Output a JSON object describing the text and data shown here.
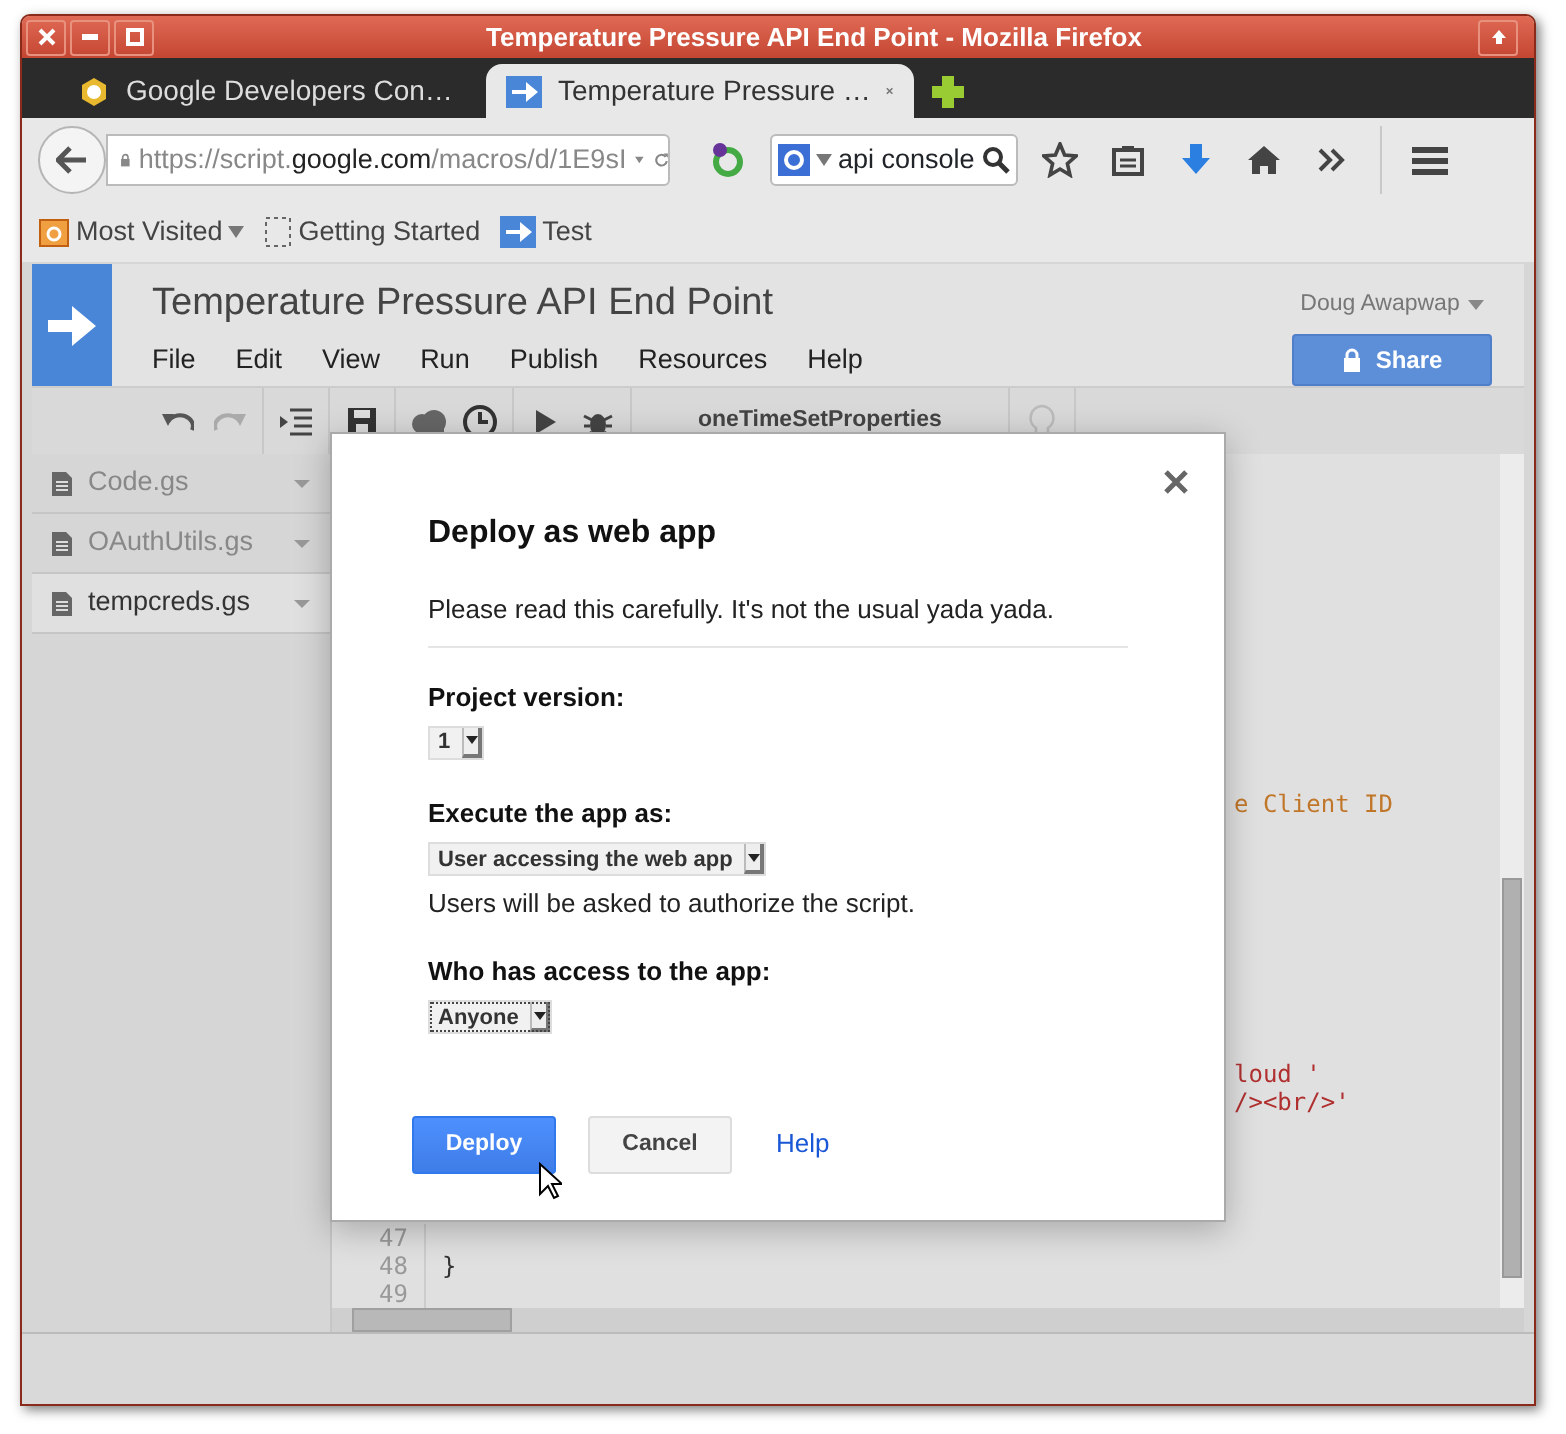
{
  "window": {
    "title": "Temperature Pressure API End Point - Mozilla Firefox"
  },
  "tabs": [
    {
      "label": "Google Developers Con…",
      "selected": false
    },
    {
      "label": "Temperature Pressure …",
      "selected": true
    }
  ],
  "address_bar": {
    "url_parts": [
      {
        "text": "https://script.",
        "emphasis": false
      },
      {
        "text": "google.com",
        "emphasis": true
      },
      {
        "text": "/macros/d/1E9sI",
        "emphasis": false
      }
    ]
  },
  "search": {
    "value": "api console"
  },
  "bookmarks": [
    {
      "label": "Most Visited",
      "kind": "folder"
    },
    {
      "label": "Getting Started",
      "kind": "page"
    },
    {
      "label": "Test",
      "kind": "script"
    }
  ],
  "app": {
    "title": "Temperature Pressure API End Point",
    "menu": [
      "File",
      "Edit",
      "View",
      "Run",
      "Publish",
      "Resources",
      "Help"
    ],
    "user": "Doug Awapwap",
    "share_button": "Share"
  },
  "toolbar": {
    "function_name": "oneTimeSetProperties"
  },
  "files": [
    {
      "name": "Code.gs",
      "selected": false
    },
    {
      "name": "OAuthUtils.gs",
      "selected": false
    },
    {
      "name": "tempcreds.gs",
      "selected": true
    }
  ],
  "editor": {
    "fragments": [
      {
        "text": "e Client ID",
        "kind": "comment"
      },
      {
        "text": "loud '",
        "kind": "string"
      },
      {
        "text": "/><br/>'",
        "kind": "string"
      }
    ],
    "lines": [
      {
        "number": "47"
      },
      {
        "number": "48",
        "code": "}"
      },
      {
        "number": "49"
      }
    ]
  },
  "dialog": {
    "title": "Deploy as web app",
    "intro": "Please read this carefully. It's not the usual yada yada.",
    "fields": [
      {
        "label": "Project version:",
        "value": "1",
        "focused": false
      },
      {
        "label": "Execute the app as:",
        "value": "User accessing the web app",
        "hint": "Users will be asked to authorize the script.",
        "focused": false
      },
      {
        "label": "Who has access to the app:",
        "value": "Anyone",
        "focused": true
      }
    ],
    "buttons": [
      {
        "label": "Deploy",
        "kind": "primary"
      },
      {
        "label": "Cancel",
        "kind": "secondary"
      },
      {
        "label": "Help",
        "kind": "link"
      }
    ]
  }
}
